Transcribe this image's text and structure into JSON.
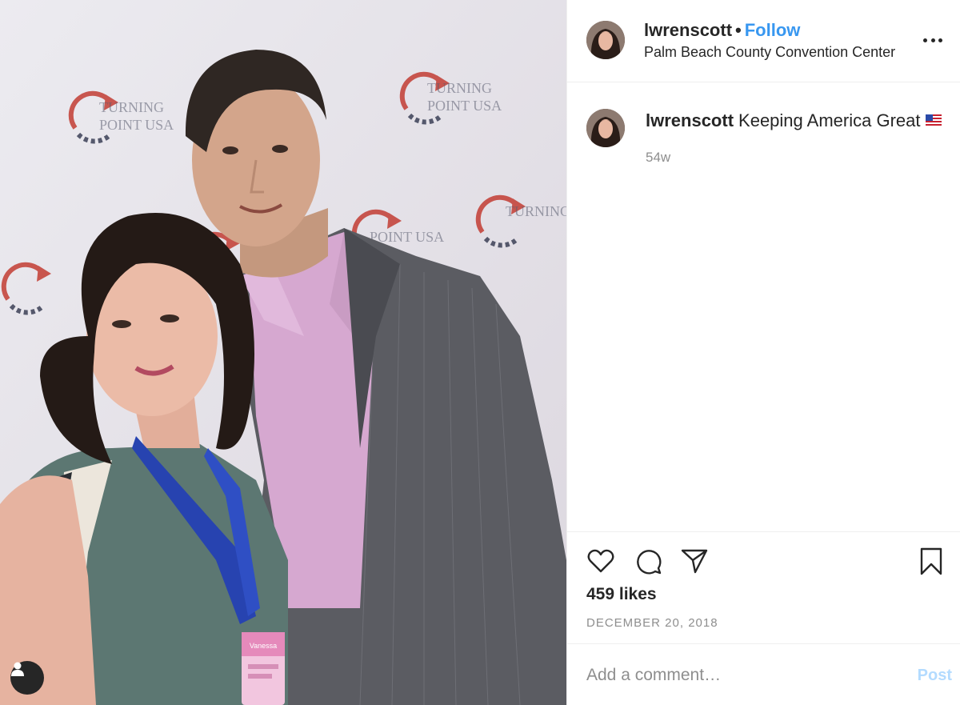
{
  "post": {
    "username": "lwrenscott",
    "follow_label": "Follow",
    "separator": "•",
    "location": "Palm Beach County Convention Center"
  },
  "photo": {
    "backdrop_logo_text": [
      "TURNING",
      "POINT USA"
    ],
    "badge_text": "Vanessa",
    "icons": {
      "user_tag": "user-tag-icon"
    }
  },
  "caption": {
    "username": "lwrenscott",
    "text": "Keeping America Great",
    "emoji_icon": "us-flag-icon",
    "time_ago": "54w"
  },
  "actions": {
    "icons": [
      "heart-icon",
      "comment-icon",
      "share-icon",
      "bookmark-icon"
    ]
  },
  "stats": {
    "likes": "459 likes",
    "date": "DECEMBER 20, 2018"
  },
  "comment": {
    "placeholder": "Add a comment…",
    "post_label": "Post"
  },
  "colors": {
    "link_blue": "#3897f0",
    "post_disabled": "#b3dbff",
    "muted": "#8e8e8e",
    "text": "#262626"
  }
}
